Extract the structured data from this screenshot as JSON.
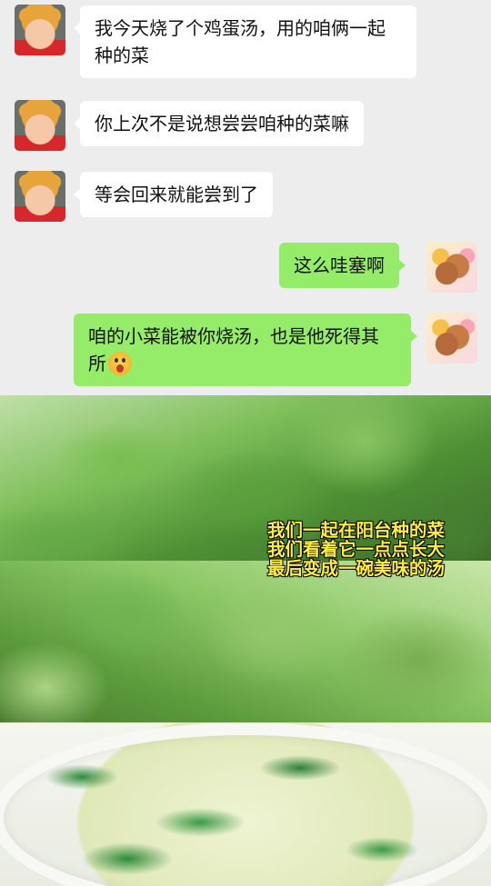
{
  "messages": [
    {
      "side": "left",
      "avatar": "kid-avatar",
      "text": "我今天烧了个鸡蛋汤，用的咱俩一起种的菜"
    },
    {
      "side": "left",
      "avatar": "kid-avatar",
      "text": "你上次不是说想尝尝咱种的菜嘛"
    },
    {
      "side": "left",
      "avatar": "kid-avatar",
      "text": "等会回来就能尝到了"
    },
    {
      "side": "right",
      "avatar": "deer-avatar",
      "text": "这么哇塞啊"
    },
    {
      "side": "right",
      "avatar": "deer-avatar",
      "text": "咱的小菜能被你烧汤，也是他死得其所",
      "emoji": "tongue-out-face-icon"
    }
  ],
  "photo": {
    "caption_lines": [
      "我们一起在阳台种的菜",
      "我们看着它一点点长大",
      "最后变成一碗美味的汤"
    ]
  },
  "colors": {
    "background": "#ededed",
    "left_bubble": "#ffffff",
    "right_bubble": "#95ec69",
    "caption": "#ffef3a"
  }
}
